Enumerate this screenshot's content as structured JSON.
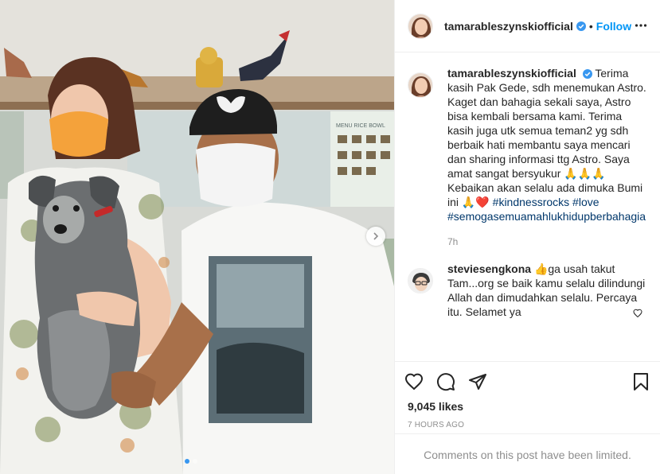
{
  "header": {
    "username": "tamarableszynskiofficial",
    "separator": "•",
    "follow_label": "Follow"
  },
  "caption": {
    "username": "tamarableszynskiofficial",
    "text": "Terima kasih Pak Gede, sdh menemukan Astro. Kaget dan bahagia sekali saya, Astro bisa kembali bersama kami. Terima kasih juga utk semua teman2 yg sdh berbaik hati membantu saya mencari dan sharing informasi ttg Astro. Saya amat sangat bersyukur 🙏🙏🙏 Kebaikan akan selalu ada dimuka Bumi ini 🙏❤️",
    "hashtags": [
      "#kindnessrocks",
      "#love",
      "#semogasemuamahlukhidupberbahagia"
    ],
    "time": "7h"
  },
  "comments": [
    {
      "username": "steviesengkona",
      "text": "👍ga usah takut Tam...org se baik kamu selalu dilindungi Allah dan dimudahkan selalu. Percaya itu. Selamet ya"
    }
  ],
  "likes": "9,045 likes",
  "timestamp": "7 HOURS AGO",
  "comments_limited": "Comments on this post have been limited.",
  "media": {
    "carousel_count": 2,
    "carousel_active": 0,
    "icons": [
      "chevron-right-icon"
    ]
  },
  "colors": {
    "accent": "#0095f6",
    "verified": "#3897f0",
    "hashtag": "#00376b",
    "muted": "#8e8e8e"
  }
}
